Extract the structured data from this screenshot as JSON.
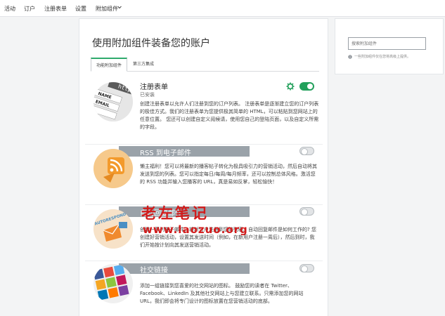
{
  "topnav": {
    "items": [
      "活动",
      "订户",
      "注册表单",
      "设置",
      "附加组件"
    ]
  },
  "main": {
    "title": "使用附加组件装备您的账户",
    "tabs": [
      {
        "label": "功能附加组件",
        "active": true
      },
      {
        "label": "第三方集成",
        "active": false
      }
    ],
    "addons": [
      {
        "name": "注册表单",
        "status": "已安装",
        "enabled": true,
        "image": "signup-form-illustration",
        "image_text": [
          "http://g",
          "NAME",
          "EMAIL"
        ],
        "description": "创建注册表单以允许人们注册到您的订户列表。 注册表单是逐渐建立您的订户列表的极佳方式。我们的注册表单为您提供极其简单的 HTML，可以粘贴到您网站上的任意位置。 您还可以创建自定义阅候请，使用您自己的登陆页面，以及自定义所需的字段。"
      },
      {
        "name": "RSS 到电子邮件",
        "enabled": false,
        "image": "rss-feed-illustration",
        "description": "懒主福利！您可以将最新的播客帖子转化为极具吸引力的营销活动，然后自动将其发送到您的列表。您可以指定每日/每周/每月频率，还可以控制总体风格。激活您的 RSS 功能并输入您播客的 URL，真是易如反掌，轻松愉快！"
      },
      {
        "name": "自动回复邮件",
        "enabled": false,
        "image": "autoresponder-illustration",
        "image_text": "AUTORESPOND",
        "description": "创建一系列电子邮件，将新订户注册到您的列表。自动回复邮件是如何工作的? 您创建好营销活动，设置其发送时间（例如，在新用户注册一周后），然后到时，我们开始按计划向其发送营销活动。"
      },
      {
        "name": "社交链接",
        "enabled": false,
        "image": "social-links-illustration",
        "description": "添加一组链接到您喜爱的社交网站的图标。 鼓励您的读者在 Twitter、Facebook、LinkedIn 及其他社交网站上与您建立联系。只需添加您的网站 URL，我们即会将专门设计的图标放置在您营销活动的底部。"
      }
    ]
  },
  "sidebar": {
    "search_placeholder": "搜索附加组件",
    "hint": "一些附加组件仅在您将高级上提供。"
  },
  "watermark": {
    "line1": "老左笔记",
    "line2": "www.laozuo.org"
  },
  "icons": [
    "chevron-down-icon",
    "gear-icon",
    "info-icon"
  ],
  "colors": {
    "accent": "#2eaa6c",
    "toggle_on": "#22a05b",
    "band": "#9aa2a9",
    "watermark": "#d21b1b"
  }
}
